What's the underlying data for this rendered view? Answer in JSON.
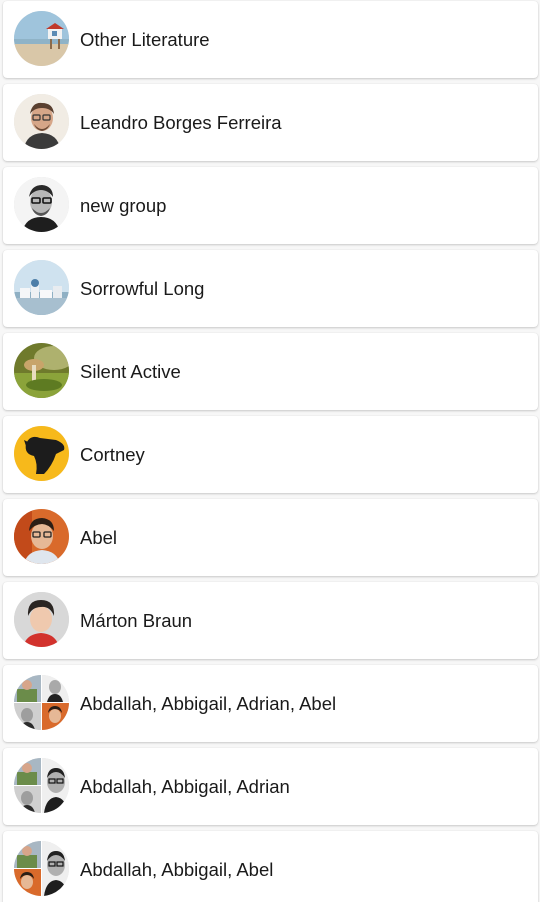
{
  "conversations": [
    {
      "name": "Other Literature",
      "avatar": "beach-lifeguard-tower-photo"
    },
    {
      "name": "Leandro Borges Ferreira",
      "avatar": "man-glasses-portrait"
    },
    {
      "name": "new group",
      "avatar": "man-glasses-bw-portrait"
    },
    {
      "name": "Sorrowful Long",
      "avatar": "white-village-photo"
    },
    {
      "name": "Silent Active",
      "avatar": "mushroom-macro-photo"
    },
    {
      "name": "Cortney",
      "avatar": "black-dog-on-yellow"
    },
    {
      "name": "Abel",
      "avatar": "young-man-glasses-portrait"
    },
    {
      "name": "Márton Braun",
      "avatar": "young-man-red-shirt-portrait"
    },
    {
      "name": "Abdallah, Abbigail, Adrian, Abel",
      "avatar": "group-four-collage"
    },
    {
      "name": "Abdallah, Abbigail, Adrian",
      "avatar": "group-three-collage"
    },
    {
      "name": "Abdallah, Abbigail, Abel",
      "avatar": "group-three-collage"
    }
  ]
}
